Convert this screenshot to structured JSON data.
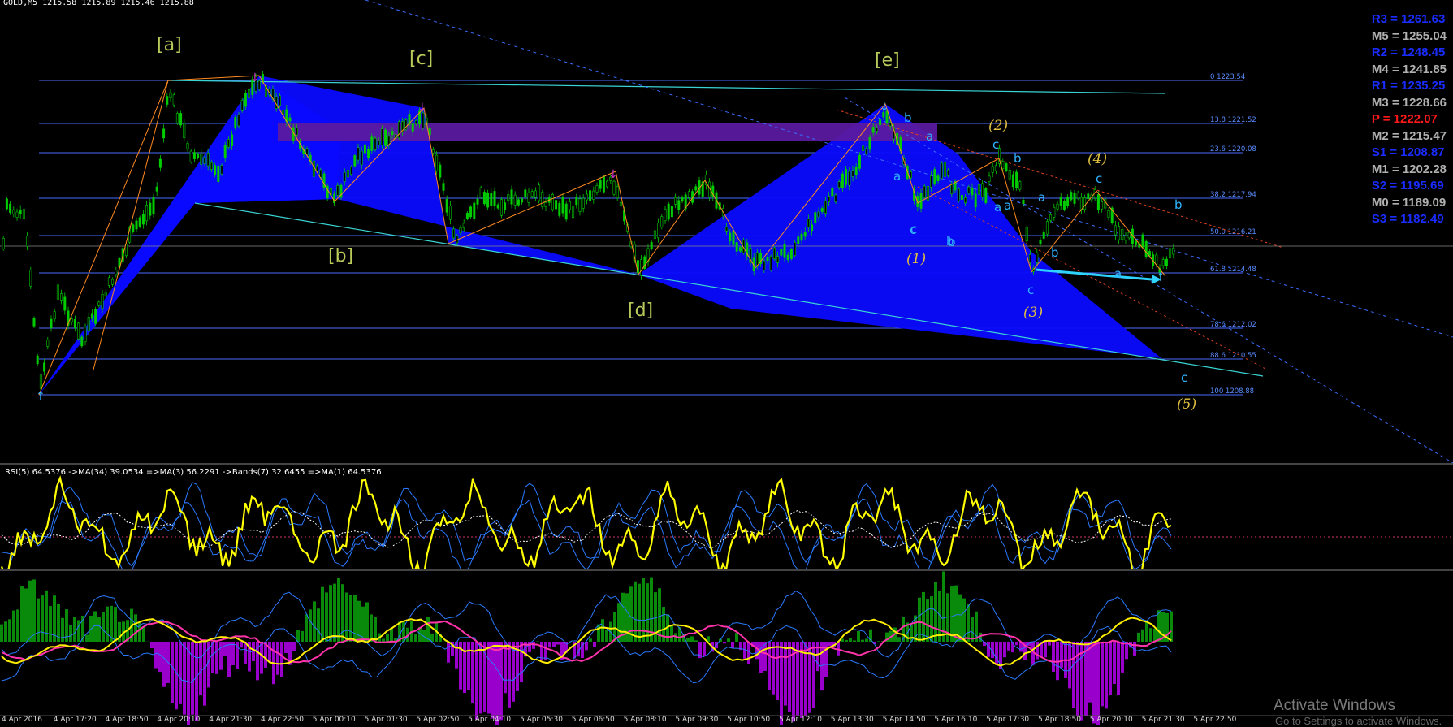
{
  "window": {
    "symbol_header": "GOLD,M5  1215.58 1215.89 1215.46 1215.88"
  },
  "colors": {
    "background": "#000000",
    "candle": "#00cc00",
    "fibo": "#4a6cff",
    "pattern_fill": "#0a0aff",
    "zone_fill": "#5a1aa0",
    "wave_label_major": "#b9c95a",
    "wave_label_minor": "#2fb3ff",
    "wave_label_impulse": "#e0c040",
    "rsi": "#ffff00",
    "osc_pos": "#0a8a0a",
    "osc_neg": "#9900cc"
  },
  "wave_labels": {
    "major": [
      "[a]",
      "[b]",
      "[c]",
      "[d]",
      "[e]"
    ],
    "impulse": [
      "(1)",
      "(2)",
      "(3)",
      "(4)",
      "(5)"
    ],
    "minor": [
      "b",
      "a",
      "a",
      "c",
      "b",
      "c",
      "b",
      "a",
      "a",
      "c",
      "b",
      "c",
      "a",
      "b",
      "c",
      "c",
      "b",
      "a"
    ]
  },
  "fibo_levels": [
    {
      "label": "0 1223.54"
    },
    {
      "label": "13.8 1221.52"
    },
    {
      "label": "23.6 1220.08"
    },
    {
      "label": "38.2 1217.94"
    },
    {
      "label": "50.0 1216.21"
    },
    {
      "label": "61.8 1214.48"
    },
    {
      "label": "78.6 1212.02"
    },
    {
      "label": "88.6 1210.55"
    },
    {
      "label": "100 1208.88"
    }
  ],
  "pivots": [
    {
      "text": "R3 = 1261.63",
      "color": "#1a2cff"
    },
    {
      "text": "M5 = 1255.04",
      "color": "#b0b0b0"
    },
    {
      "text": "R2 = 1248.45",
      "color": "#1a2cff"
    },
    {
      "text": "M4 = 1241.85",
      "color": "#b0b0b0"
    },
    {
      "text": "R1 = 1235.25",
      "color": "#1a2cff"
    },
    {
      "text": "M3 = 1228.66",
      "color": "#b0b0b0"
    },
    {
      "text": "P   = 1222.07",
      "color": "#ff1a1a"
    },
    {
      "text": "M2 = 1215.47",
      "color": "#b0b0b0"
    },
    {
      "text": "S1 = 1208.87",
      "color": "#1a2cff"
    },
    {
      "text": "M1 = 1202.28",
      "color": "#b0b0b0"
    },
    {
      "text": "S2 = 1195.69",
      "color": "#1a2cff"
    },
    {
      "text": "M0 = 1189.09",
      "color": "#b0b0b0"
    },
    {
      "text": "S3 = 1182.49",
      "color": "#1a2cff"
    }
  ],
  "rsi_panel": {
    "title": "RSI(5) 64.5376  ->MA(34) 39.0534  =>MA(3) 56.2291  ->Bands(7) 32.6455  =>MA(1) 64.5376"
  },
  "time_axis": [
    "4 Apr 2016",
    "4 Apr 17:20",
    "4 Apr 18:50",
    "4 Apr 20:10",
    "4 Apr 21:30",
    "4 Apr 22:50",
    "5 Apr 00:10",
    "5 Apr 01:30",
    "5 Apr 02:50",
    "5 Apr 04:10",
    "5 Apr 05:30",
    "5 Apr 06:50",
    "5 Apr 08:10",
    "5 Apr 09:30",
    "5 Apr 10:50",
    "5 Apr 12:10",
    "5 Apr 13:30",
    "5 Apr 14:50",
    "5 Apr 16:10",
    "5 Apr 17:30",
    "5 Apr 18:50",
    "5 Apr 20:10",
    "5 Apr 21:30",
    "5 Apr 22:50"
  ],
  "watermark": {
    "line1": "Activate Windows",
    "line2": "Go to Settings to activate Windows."
  }
}
